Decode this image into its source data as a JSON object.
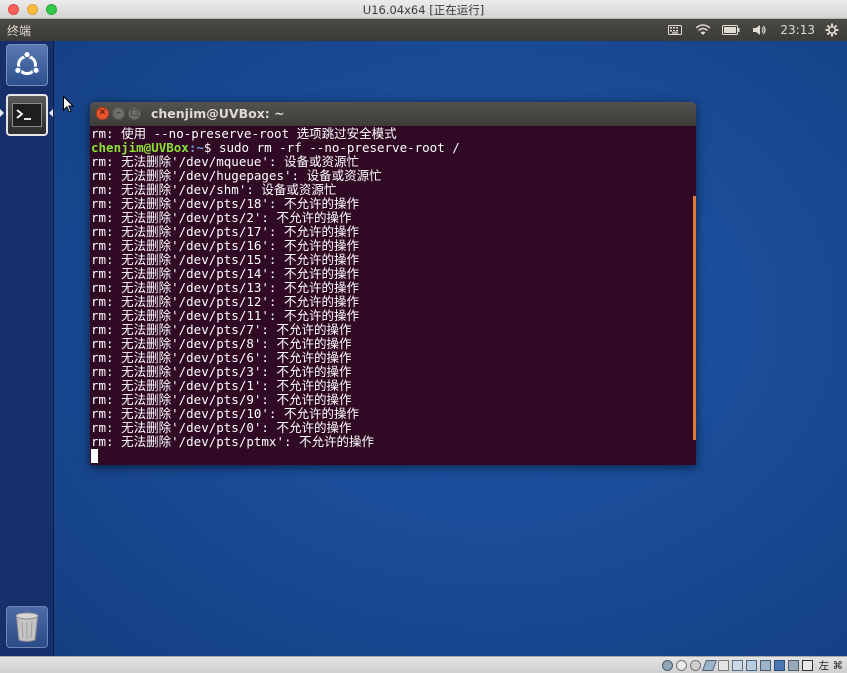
{
  "host_window": {
    "title": "U16.04x64 [正在运行]"
  },
  "ubuntu_panel": {
    "app_name": "终端",
    "clock": "23:13",
    "indicators": [
      "keyboard-icon",
      "wifi-icon",
      "battery-icon",
      "volume-icon",
      "gear-icon"
    ]
  },
  "launcher": {
    "items": [
      {
        "name": "dash-home",
        "icon": "ubuntu-logo-icon"
      },
      {
        "name": "terminal",
        "icon": "terminal-icon",
        "active": true
      },
      {
        "name": "trash",
        "icon": "trash-icon"
      }
    ]
  },
  "terminal": {
    "title": "chenjim@UVBox: ~",
    "prompt_user": "chenjim@UVBox",
    "prompt_path": ":~",
    "prompt_symbol": "$ ",
    "lines": [
      {
        "text": "rm: 使用 --no-preserve-root 选项跳过安全模式"
      },
      {
        "prompt": true,
        "command": "sudo rm -rf --no-preserve-root /"
      },
      {
        "text": "rm: 无法删除'/dev/mqueue': 设备或资源忙"
      },
      {
        "text": "rm: 无法删除'/dev/hugepages': 设备或资源忙"
      },
      {
        "text": "rm: 无法删除'/dev/shm': 设备或资源忙"
      },
      {
        "text": "rm: 无法删除'/dev/pts/18': 不允许的操作"
      },
      {
        "text": "rm: 无法删除'/dev/pts/2': 不允许的操作"
      },
      {
        "text": "rm: 无法删除'/dev/pts/17': 不允许的操作"
      },
      {
        "text": "rm: 无法删除'/dev/pts/16': 不允许的操作"
      },
      {
        "text": "rm: 无法删除'/dev/pts/15': 不允许的操作"
      },
      {
        "text": "rm: 无法删除'/dev/pts/14': 不允许的操作"
      },
      {
        "text": "rm: 无法删除'/dev/pts/13': 不允许的操作"
      },
      {
        "text": "rm: 无法删除'/dev/pts/12': 不允许的操作"
      },
      {
        "text": "rm: 无法删除'/dev/pts/11': 不允许的操作"
      },
      {
        "text": "rm: 无法删除'/dev/pts/7': 不允许的操作"
      },
      {
        "text": "rm: 无法删除'/dev/pts/8': 不允许的操作"
      },
      {
        "text": "rm: 无法删除'/dev/pts/6': 不允许的操作"
      },
      {
        "text": "rm: 无法删除'/dev/pts/3': 不允许的操作"
      },
      {
        "text": "rm: 无法删除'/dev/pts/1': 不允许的操作"
      },
      {
        "text": "rm: 无法删除'/dev/pts/9': 不允许的操作"
      },
      {
        "text": "rm: 无法删除'/dev/pts/10': 不允许的操作"
      },
      {
        "text": "rm: 无法删除'/dev/pts/0': 不允许的操作"
      },
      {
        "text": "rm: 无法删除'/dev/pts/ptmx': 不允许的操作"
      }
    ]
  },
  "vbox_status": {
    "host_key": "左 ⌘"
  },
  "colors": {
    "terminal_bg": "#300a24",
    "prompt_user": "#8ae234",
    "prompt_path": "#729fcf",
    "desktop": "#1a4c98",
    "launcher": "#17306b"
  }
}
